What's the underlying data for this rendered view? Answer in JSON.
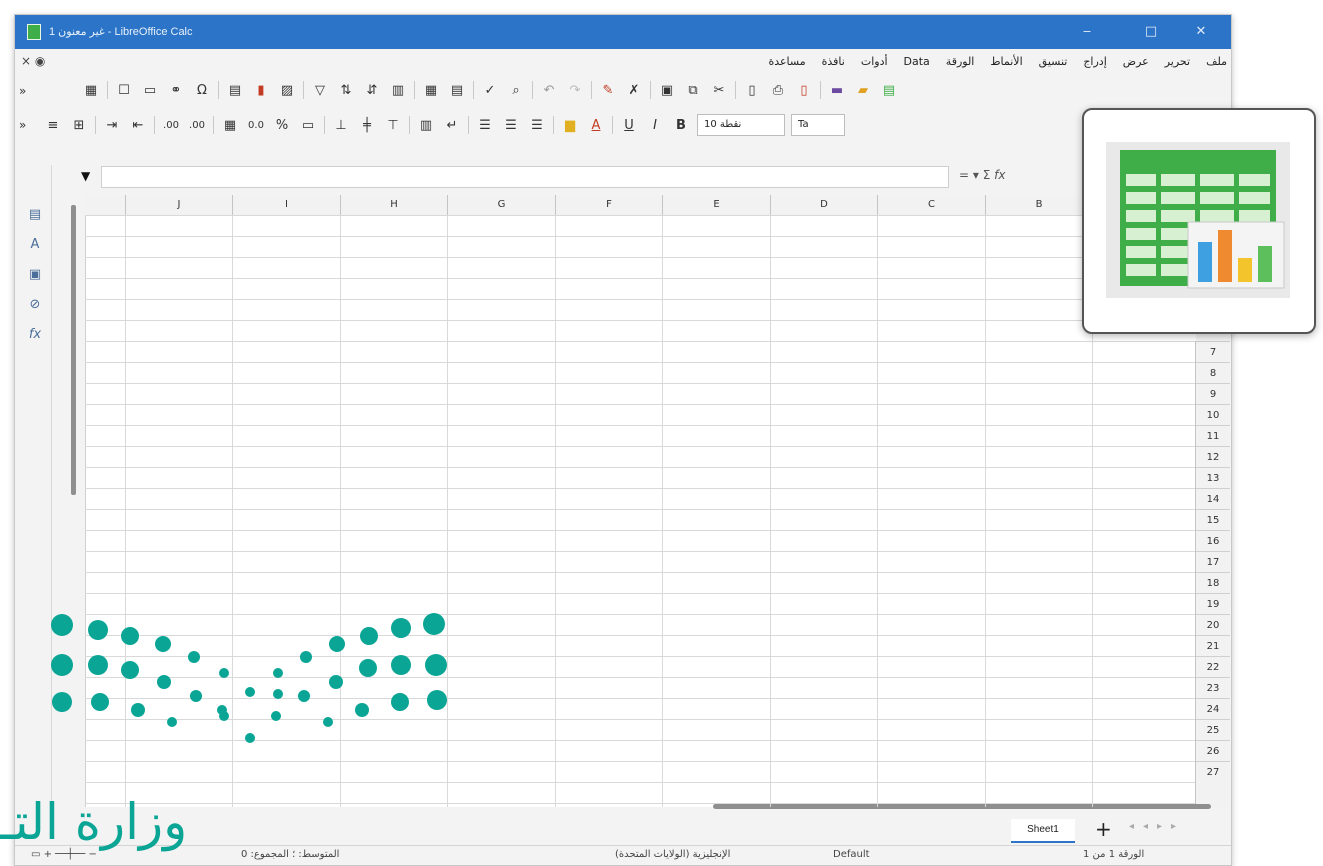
{
  "window": {
    "title": "غير معنون 1 - LibreOffice Calc",
    "controls": {
      "minimize": "‒",
      "maximize": "□",
      "close": "✕"
    }
  },
  "menu": {
    "items": [
      "ملف",
      "تحرير",
      "عرض",
      "إدراج",
      "تنسيق",
      "الأنماط",
      "الورقة",
      "Data",
      "أدوات",
      "نافذة",
      "مساعدة"
    ]
  },
  "toolbar": {
    "font_size": "10 نقطة",
    "font_name": "Ta"
  },
  "formula_bar": {
    "cell_ref": "",
    "value": ""
  },
  "grid": {
    "columns": [
      "J",
      "I",
      "H",
      "G",
      "F",
      "E",
      "D",
      "C",
      "B"
    ],
    "visible_rows": [
      "7",
      "8",
      "9",
      "10",
      "11",
      "12",
      "13",
      "14",
      "15",
      "16",
      "17",
      "18",
      "19",
      "20",
      "21",
      "22",
      "23",
      "24",
      "25",
      "26",
      "27"
    ]
  },
  "sheet_tabs": {
    "tabs": [
      "Sheet1"
    ],
    "add_symbol": "+"
  },
  "status_bar": {
    "page": "الورقة 1 من 1",
    "style": "Default",
    "language": "الإنجليزية (الولايات المتحدة)",
    "summary": "المتوسط: ؛ المجموع: 0"
  },
  "overlay": {
    "logo_text": "وزارة التـ"
  },
  "icons": {
    "popup": "spreadsheet-chart-icon",
    "app": "calc-app-icon"
  },
  "colors": {
    "titlebar": "#2b74c7",
    "logo_teal": "#0aa595",
    "sheet_green": "#3fae49"
  }
}
